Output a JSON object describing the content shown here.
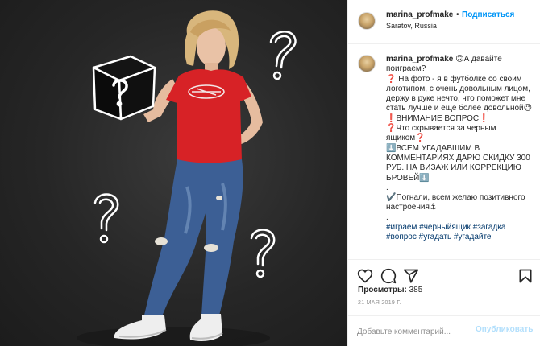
{
  "post": {
    "username": "marina_profmake",
    "separator": "•",
    "follow_label": "Подписаться",
    "location": "Saratov, Russia"
  },
  "caption": {
    "username": "marina_profmake",
    "body": " 🙃А давайте поиграем?\n❓ На фото - я в футболке со своим логотипом, с очень довольным лицом, держу в руке нечто, что поможет мне стать лучше и еще более довольной😉\n❗ВНИМАНИЕ ВОПРОС❗\n❓Что скрывается за черным ящиком❓\n⬇️ВСЕМ УГАДАВШИМ В КОММЕНТАРИЯХ ДАРЮ СКИДКУ 300 РУБ. НА ВИЗАЖ ИЛИ КОРРЕКЦИЮ БРОВЕЙ⬇️\n.\n✔️Погнали, всем желаю позитивного настроения⚓\n.\n",
    "hashtags": "#играем #черныйящик #загадка #вопрос #угадать #угадайте"
  },
  "stats": {
    "views_label": "Просмотры:",
    "views_value": "385",
    "date": "21 МАЯ 2019 Г."
  },
  "comment_box": {
    "placeholder": "Добавьте комментарий...",
    "publish_label": "Опубликовать"
  },
  "icons": {
    "like": "heart-icon",
    "comment": "comment-bubble-icon",
    "share": "paper-plane-icon",
    "save": "bookmark-icon",
    "photo_marks": "question-mark-icon"
  },
  "colors": {
    "accent": "#0095f6",
    "publish_disabled": "#b2dffc",
    "muted": "#8e8e8e",
    "border": "#efefef"
  }
}
